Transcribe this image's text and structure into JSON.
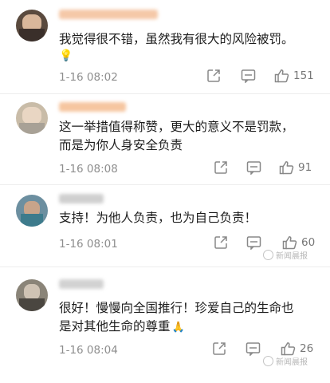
{
  "comments": [
    {
      "text": "我觉得很不错，虽然我有很大的风险被罚。",
      "emoji": "💡",
      "time": "1-16 08:02",
      "likes": "151"
    },
    {
      "text": "这一举措值得称赞，更大的意义不是罚款，\n而是为你人身安全负责",
      "time": "1-16 08:08",
      "likes": "91"
    },
    {
      "text": "支持！为他人负责，也为自己负责！",
      "time": "1-16 08:01",
      "likes": "60"
    },
    {
      "text": "很好！慢慢向全国推行！珍爱自己的生命也\n是对其他生命的尊重",
      "emoji": "🙏",
      "time": "1-16 08:04",
      "likes": "26"
    }
  ],
  "watermark": "新闻晨报",
  "colors": {
    "like": "#888888",
    "text": "#1d1d1d",
    "meta": "#8e8e8e"
  },
  "icons": {
    "share": "share-icon",
    "reply": "comment-icon",
    "like": "thumbs-up-icon"
  }
}
